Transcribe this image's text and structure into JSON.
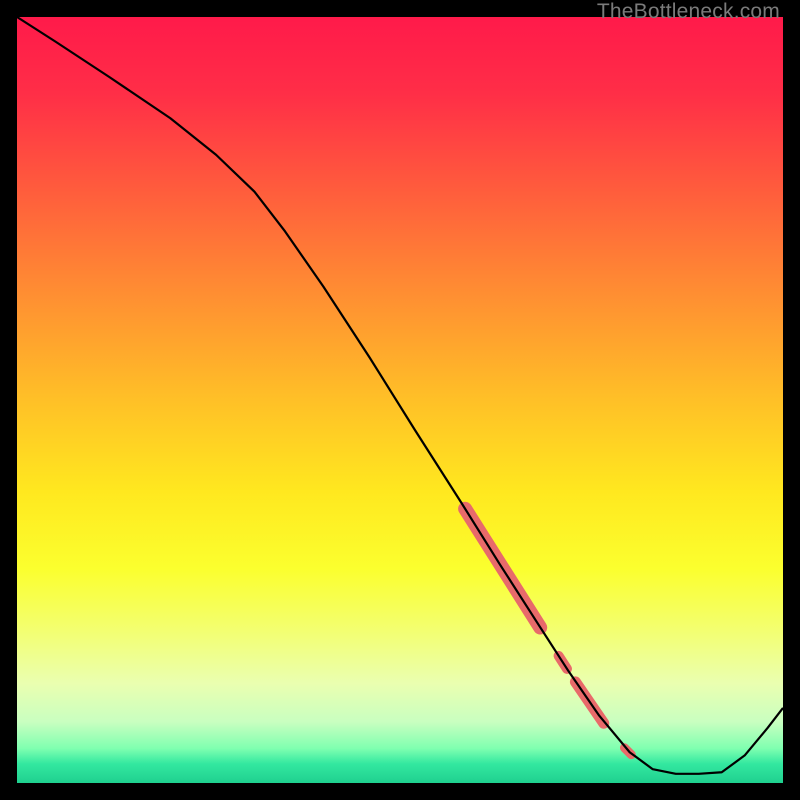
{
  "watermark": "TheBottleneck.com",
  "chart_data": {
    "type": "line",
    "title": "",
    "xlabel": "",
    "ylabel": "",
    "xlim": [
      0,
      100
    ],
    "ylim": [
      0,
      100
    ],
    "grid": false,
    "background_gradient": {
      "stops": [
        {
          "pos": 0.0,
          "color": "#ff1a4a"
        },
        {
          "pos": 0.1,
          "color": "#ff2e47"
        },
        {
          "pos": 0.22,
          "color": "#ff5a3d"
        },
        {
          "pos": 0.35,
          "color": "#ff8a33"
        },
        {
          "pos": 0.5,
          "color": "#ffc027"
        },
        {
          "pos": 0.62,
          "color": "#ffe81f"
        },
        {
          "pos": 0.72,
          "color": "#fbff2e"
        },
        {
          "pos": 0.8,
          "color": "#f3ff70"
        },
        {
          "pos": 0.87,
          "color": "#eaffb0"
        },
        {
          "pos": 0.92,
          "color": "#c9ffc0"
        },
        {
          "pos": 0.955,
          "color": "#7fffb0"
        },
        {
          "pos": 0.975,
          "color": "#33e8a0"
        },
        {
          "pos": 1.0,
          "color": "#1fd08f"
        }
      ]
    },
    "series": [
      {
        "name": "curve",
        "stroke": "#000000",
        "stroke_width": 2.2,
        "points": [
          {
            "x": 0.0,
            "y": 100.0
          },
          {
            "x": 5.0,
            "y": 96.8
          },
          {
            "x": 12.0,
            "y": 92.2
          },
          {
            "x": 20.0,
            "y": 86.8
          },
          {
            "x": 26.0,
            "y": 82.0
          },
          {
            "x": 31.0,
            "y": 77.2
          },
          {
            "x": 35.0,
            "y": 72.0
          },
          {
            "x": 40.0,
            "y": 64.8
          },
          {
            "x": 46.0,
            "y": 55.6
          },
          {
            "x": 52.0,
            "y": 46.0
          },
          {
            "x": 58.0,
            "y": 36.6
          },
          {
            "x": 63.0,
            "y": 28.6
          },
          {
            "x": 68.0,
            "y": 20.8
          },
          {
            "x": 72.0,
            "y": 14.6
          },
          {
            "x": 76.0,
            "y": 8.8
          },
          {
            "x": 80.0,
            "y": 4.0
          },
          {
            "x": 83.0,
            "y": 1.8
          },
          {
            "x": 86.0,
            "y": 1.2
          },
          {
            "x": 89.0,
            "y": 1.2
          },
          {
            "x": 92.0,
            "y": 1.4
          },
          {
            "x": 95.0,
            "y": 3.6
          },
          {
            "x": 98.0,
            "y": 7.2
          },
          {
            "x": 100.0,
            "y": 9.8
          }
        ]
      }
    ],
    "highlights": {
      "comment": "Thick salmon segments overlaid on the main curve",
      "stroke": "#e86a6a",
      "segments": [
        {
          "width": 14,
          "points": [
            {
              "x": 58.5,
              "y": 35.8
            },
            {
              "x": 68.3,
              "y": 20.3
            }
          ]
        },
        {
          "width": 10,
          "points": [
            {
              "x": 70.7,
              "y": 16.6
            },
            {
              "x": 71.8,
              "y": 14.9
            }
          ]
        },
        {
          "width": 11,
          "points": [
            {
              "x": 72.9,
              "y": 13.2
            },
            {
              "x": 76.6,
              "y": 7.8
            }
          ]
        },
        {
          "width": 9,
          "points": [
            {
              "x": 79.3,
              "y": 4.6
            },
            {
              "x": 80.2,
              "y": 3.7
            }
          ]
        }
      ]
    }
  }
}
